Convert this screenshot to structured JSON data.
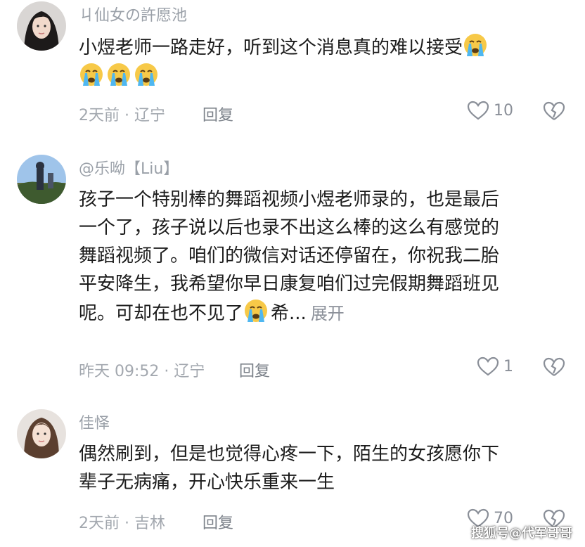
{
  "comments": [
    {
      "username": "ㄐ仙女の許愿池",
      "lines": [
        "小煜老师一路走好，听到这个消息真的难以接受"
      ],
      "emoji_row_count": 3,
      "time_location": "2天前 · 辽宁",
      "reply_label": "回复",
      "like_count": "10",
      "avatar_icon": "avatar-woman-dark-hair"
    },
    {
      "username": "@乐呦【Liu】",
      "lines": [
        "孩子一个特别棒的舞蹈视频小煜老师录的，也是最后",
        "一个了，孩子说以后也录不出这么棒的这么有感觉的",
        "舞蹈视频了。咱们的微信对话还停留在，你祝我二胎",
        "平安降生，我希望你早日康复咱们过完假期舞蹈班见",
        "呢。可却在也不见了"
      ],
      "trailing_text": "希...",
      "expand_label": "展开",
      "time_location": "昨天 09:52 · 辽宁",
      "reply_label": "回复",
      "like_count": "1",
      "avatar_icon": "avatar-outdoor-scene"
    },
    {
      "username": "佳怿",
      "lines": [
        "偶然刷到，但是也觉得心疼一下，陌生的女孩愿你下",
        "辈子无病痛，开心快乐重来一生"
      ],
      "time_location": "2天前 · 吉林",
      "reply_label": "回复",
      "like_count": "70",
      "avatar_icon": "avatar-woman-light-hair"
    }
  ],
  "watermark": "搜狐号@代军哥哥",
  "colors": {
    "text": "#1c1c1c",
    "muted": "#a3a8af",
    "emoji_face": "#f7c948",
    "emoji_tear": "#4fb7f0"
  }
}
